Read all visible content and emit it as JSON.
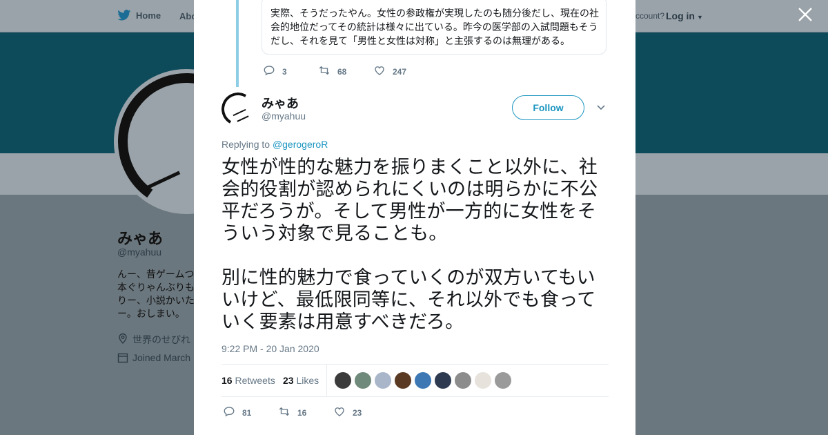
{
  "nav": {
    "home": "Home",
    "about": "Abo",
    "account_prompt": "ccount?",
    "login": "Log in"
  },
  "profile": {
    "name": "みゃあ",
    "handle": "@myahuu",
    "bio": "んー、昔ゲームつ\n本ぐりゃんぶりも\nりー、小説かいた\nー。おしまい。",
    "location": "世界のせびれ",
    "joined": "Joined March"
  },
  "modal": {
    "quoted_text": "実際、そうだったやん。女性の参政権が実現したのも随分後だし、現在の社会的地位だってその統計は様々に出ている。昨今の医学部の入試問題もそうだし、それを見て「男性と女性は対称」と主張するのは無理がある。",
    "prev_actions": {
      "replies": "3",
      "retweets": "68",
      "likes": "247"
    },
    "author": {
      "name": "みゃあ",
      "handle": "@myahuu"
    },
    "follow_label": "Follow",
    "replying_prefix": "Replying to",
    "replying_to": "@gerogeroR",
    "tweet_text": "女性が性的な魅力を振りまくこと以外に、社会的役割が認められにくいのは明らかに不公平だろうが。そして男性が一方的に女性をそういう対象で見ることも。\n\n別に性的魅力で食っていくのが双方いてもいいけど、最低限同等に、それ以外でも食っていく要素は用意すべきだろ。",
    "timestamp": "9:22 PM - 20 Jan 2020",
    "stats": {
      "retweets_count": "16",
      "retweets_label": "Retweets",
      "likes_count": "23",
      "likes_label": "Likes"
    },
    "likers": [
      "#3b3b3b",
      "#6f8a7a",
      "#a9b6c9",
      "#5a3a22",
      "#3d78b5",
      "#2d3a4f",
      "#8c8c8c",
      "#e7e2dc",
      "#9a9a9a"
    ],
    "actions": {
      "replies": "81",
      "retweets": "16",
      "likes": "23"
    }
  },
  "colors": {
    "accent": "#1b95c0",
    "thread_line": "#8ecde6",
    "banner": "#0d4a5a"
  },
  "icons": [
    "twitter-bird-icon",
    "close-icon",
    "reply-icon",
    "retweet-icon",
    "like-icon",
    "chevron-down-icon",
    "location-icon",
    "calendar-icon"
  ]
}
